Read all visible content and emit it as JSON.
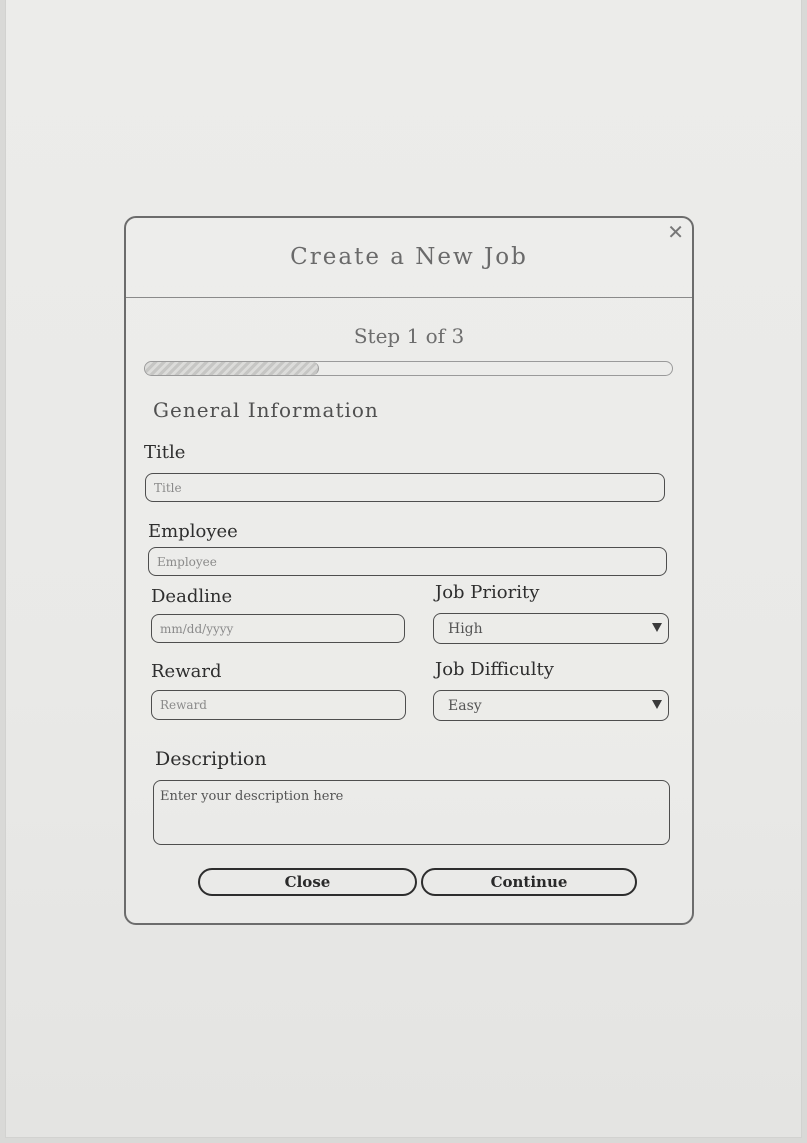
{
  "dialog": {
    "title": "Create a New Job",
    "close_icon": "✕"
  },
  "progress": {
    "step_label": "Step 1 of 3",
    "current_step": 1,
    "total_steps": 3,
    "fraction": 0.33
  },
  "section": {
    "title": "General Information"
  },
  "fields": {
    "title": {
      "label": "Title",
      "placeholder": "Title"
    },
    "employee": {
      "label": "Employee",
      "placeholder": "Employee"
    },
    "deadline": {
      "label": "Deadline",
      "placeholder": "mm/dd/yyyy"
    },
    "reward": {
      "label": "Reward",
      "placeholder": "Reward"
    },
    "priority": {
      "label": "Job Priority",
      "value": "High"
    },
    "difficulty": {
      "label": "Job Difficulty",
      "value": "Easy"
    },
    "description": {
      "label": "Description",
      "placeholder": "Enter your description here"
    }
  },
  "buttons": {
    "close_label": "Close",
    "continue_label": "Continue"
  },
  "icons": {
    "close": "close-icon",
    "dropdown": "chevron-down-icon"
  }
}
